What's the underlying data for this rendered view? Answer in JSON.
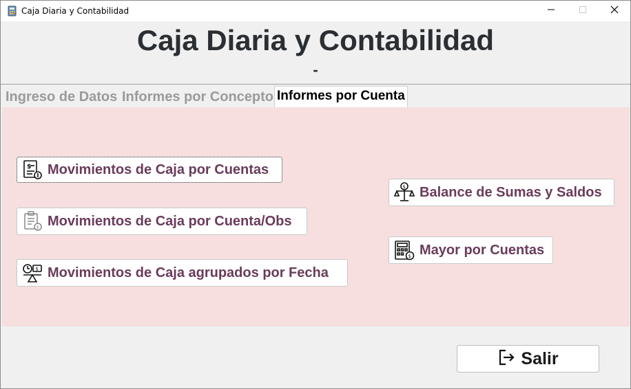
{
  "window": {
    "title": "Caja Diaria y Contabilidad",
    "icons": {
      "app": "calculator-icon",
      "minimize": "minimize-icon",
      "maximize": "maximize-icon",
      "close": "close-icon"
    }
  },
  "header": {
    "title": "Caja Diaria y Contabilidad",
    "subtitle": "-"
  },
  "tabs": [
    {
      "label": "Ingreso de Datos",
      "active": false
    },
    {
      "label": "Informes por Concepto",
      "active": false
    },
    {
      "label": "Informes por Cuenta",
      "active": true
    }
  ],
  "buttons": {
    "mov_cuentas": {
      "label": "Movimientos de Caja por Cuentas",
      "icon": "document-money-icon"
    },
    "mov_cuenta_obs": {
      "label": "Movimientos de Caja por Cuenta/Obs",
      "icon": "clipboard-coin-icon"
    },
    "mov_agrupados": {
      "label": "Movimientos de Caja agrupados por Fecha",
      "icon": "clock-scale-icon"
    },
    "balance": {
      "label": "Balance de Sumas y Saldos",
      "icon": "scale-dollar-icon"
    },
    "mayor": {
      "label": "Mayor por Cuentas",
      "icon": "calculator-dollar-icon"
    },
    "salir": {
      "label": "Salir",
      "icon": "exit-icon"
    }
  },
  "colors": {
    "panel_bg": "#f7dfdf",
    "button_text": "#6a3b5a",
    "title_text": "#2b2f33"
  }
}
